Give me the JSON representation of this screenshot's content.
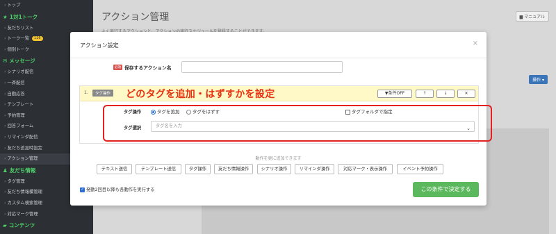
{
  "sidebar": {
    "items": [
      {
        "type": "item",
        "label": "トップ"
      },
      {
        "type": "section",
        "icon": "star-icon",
        "icon_char": "★",
        "label": "1対1トーク"
      },
      {
        "type": "item",
        "label": "友だちリスト"
      },
      {
        "type": "item",
        "label": "トーク一覧",
        "badge": "116"
      },
      {
        "type": "item",
        "label": "個別トーク"
      },
      {
        "type": "section",
        "icon": "message-icon",
        "icon_char": "✉",
        "label": "メッセージ"
      },
      {
        "type": "item",
        "label": "シナリオ配信"
      },
      {
        "type": "item",
        "label": "一斉配信"
      },
      {
        "type": "item",
        "label": "自動応答"
      },
      {
        "type": "item",
        "label": "テンプレート"
      },
      {
        "type": "item",
        "label": "予約管理"
      },
      {
        "type": "item",
        "label": "回答フォーム"
      },
      {
        "type": "item",
        "label": "リマインダ配信"
      },
      {
        "type": "item",
        "label": "友だち追加時設定"
      },
      {
        "type": "item",
        "label": "アクション管理",
        "active": true
      },
      {
        "type": "section",
        "icon": "user-icon",
        "icon_char": "♟",
        "label": "友だち情報"
      },
      {
        "type": "item",
        "label": "タグ管理"
      },
      {
        "type": "item",
        "label": "友だち情報欄管理"
      },
      {
        "type": "item",
        "label": "カスタム検索管理"
      },
      {
        "type": "item",
        "label": "対応マーク管理"
      },
      {
        "type": "section",
        "icon": "folder-icon",
        "icon_char": "▰",
        "label": "コンテンツ"
      }
    ]
  },
  "main": {
    "title": "アクション管理",
    "description": "よく実行するアクションと、アクションの実行スケジュールを登録することができます。",
    "manual_label": "マニュアル",
    "action_button": "操作 ▾"
  },
  "modal": {
    "title": "アクション設定",
    "close": "×",
    "required_badge": "必須",
    "name_label": "保存するアクション名",
    "name_value": "",
    "condition": {
      "number": "1.",
      "tag_label": "タグ操作",
      "annotation": "どのタグを追加・はずすかを設定",
      "filter_label": "条件OFF",
      "up": "↑",
      "down": "↓",
      "remove": "✕",
      "operation_label": "タグ操作",
      "option_add": "タグを追加",
      "option_remove": "タグをはずす",
      "folder_label": "タグフォルダで指定",
      "select_label": "タグ選択",
      "select_placeholder": "タグ名を入力"
    },
    "add_hint": "動作を更に追加できます",
    "actions": [
      "テキスト送信",
      "テンプレート送信",
      "タグ操作",
      "友だち情報操作",
      "シナリオ操作",
      "リマインダ操作",
      "対応マーク・表示操作",
      "イベント予約操作"
    ],
    "repeat_label": "発動2回目以降も各動作を実行する",
    "submit_label": "この条件で決定する"
  },
  "colors": {
    "sidebar_bg": "#2c2f33",
    "section_green": "#4fd06a",
    "submit_green": "#5cb85c",
    "annotation_red": "#e63312",
    "highlight_yellow": "#fff9c8"
  }
}
